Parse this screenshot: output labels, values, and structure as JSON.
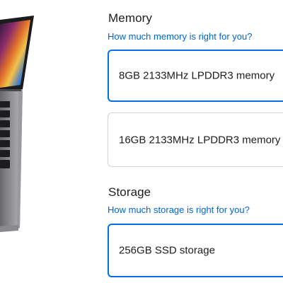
{
  "memory": {
    "title": "Memory",
    "help_link": "How much memory is right for you?",
    "options": [
      {
        "label": "8GB 2133MHz LPDDR3 memory",
        "selected": true
      },
      {
        "label": "16GB 2133MHz LPDDR3 memory",
        "selected": false
      }
    ]
  },
  "storage": {
    "title": "Storage",
    "help_link": "How much storage is right for you?",
    "options": [
      {
        "label": "256GB SSD storage",
        "selected": true
      }
    ]
  },
  "colors": {
    "accent": "#0071e3",
    "link": "#0066cc",
    "text": "#1d1d1f",
    "border": "#d2d2d7"
  }
}
